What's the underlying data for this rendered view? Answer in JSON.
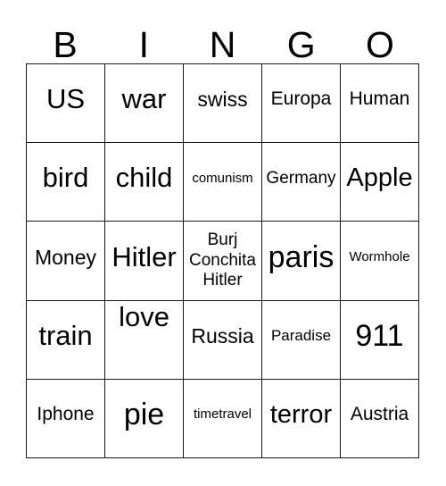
{
  "card": {
    "header_letters": [
      "B",
      "I",
      "N",
      "G",
      "O"
    ],
    "border_color": "#1a1a1a",
    "background_color": "#ffffff",
    "text_color": "#000000",
    "columns": 5,
    "rows": 5,
    "cells": [
      [
        {
          "text": "US",
          "size": "fs-xxl",
          "valign": "va-upper"
        },
        {
          "text": "war",
          "size": "fs-xxl",
          "valign": "va-upper"
        },
        {
          "text": "swiss",
          "size": "fs-l",
          "valign": "va-upper"
        },
        {
          "text": "Europa",
          "size": "fs-ml",
          "valign": "va-upper"
        },
        {
          "text": "Human",
          "size": "fs-ml",
          "valign": "va-upper"
        }
      ],
      [
        {
          "text": "bird",
          "size": "fs-xxl",
          "valign": "va-upper"
        },
        {
          "text": "child",
          "size": "fs-xxl",
          "valign": "va-upper"
        },
        {
          "text": "comunism",
          "size": "fs-xs",
          "valign": "va-upper"
        },
        {
          "text": "Germany",
          "size": "fs-m",
          "valign": "va-upper"
        },
        {
          "text": "Apple",
          "size": "fs-xl",
          "valign": "va-upper"
        }
      ],
      [
        {
          "text": "Money",
          "size": "fs-l",
          "valign": "va-upper"
        },
        {
          "text": "Hitler",
          "size": "fs-xxl",
          "valign": "va-upper"
        },
        {
          "text": "Burj Conchita Hitler",
          "size": "fs-m",
          "valign": "va-mid",
          "multiline": true
        },
        {
          "text": "paris",
          "size": "fs-xxxl",
          "valign": "va-upper"
        },
        {
          "text": "Wormhole",
          "size": "fs-xs",
          "valign": "va-upper"
        }
      ],
      [
        {
          "text": "train",
          "size": "fs-xxl",
          "valign": "va-upper"
        },
        {
          "text": "love",
          "size": "fs-xxl",
          "valign": "va-top"
        },
        {
          "text": "Russia",
          "size": "fs-l",
          "valign": "va-upper"
        },
        {
          "text": "Paradise",
          "size": "fs-s",
          "valign": "va-upper"
        },
        {
          "text": "911",
          "size": "fs-xxxl",
          "valign": "va-upper"
        }
      ],
      [
        {
          "text": "Iphone",
          "size": "fs-ml",
          "valign": "va-upper"
        },
        {
          "text": "pie",
          "size": "fs-xxxl",
          "valign": "va-upper"
        },
        {
          "text": "timetravel",
          "size": "fs-xs",
          "valign": "va-upper"
        },
        {
          "text": "terror",
          "size": "fs-xl",
          "valign": "va-upper"
        },
        {
          "text": "Austria",
          "size": "fs-ml",
          "valign": "va-upper"
        }
      ]
    ]
  }
}
